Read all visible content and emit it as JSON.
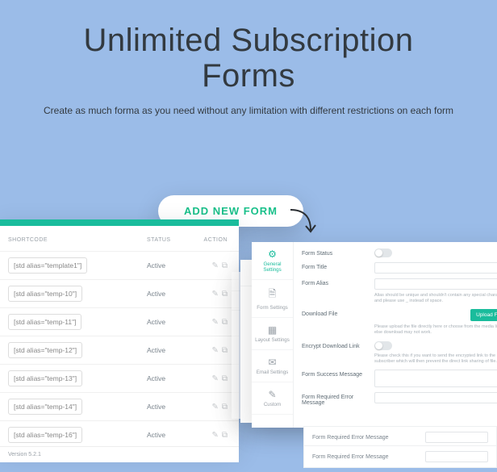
{
  "hero": {
    "title_line1": "Unlimited Subscription",
    "title_line2": "Forms",
    "subtitle": "Create as much forma as you need without any limitation with different restrictions on each form"
  },
  "add_button": "ADD NEW FORM",
  "table": {
    "head_shortcode": "SHORTCODE",
    "head_status": "STATUS",
    "head_action": "ACTION",
    "rows": [
      {
        "code": "[std alias=\"template1\"]",
        "status": "Active"
      },
      {
        "code": "[std alias=\"temp-10\"]",
        "status": "Active"
      },
      {
        "code": "[std alias=\"temp-11\"]",
        "status": "Active"
      },
      {
        "code": "[std alias=\"temp-12\"]",
        "status": "Active"
      },
      {
        "code": "[std alias=\"temp-13\"]",
        "status": "Active"
      },
      {
        "code": "[std alias=\"temp-14\"]",
        "status": "Active"
      },
      {
        "code": "[std alias=\"temp-16\"]",
        "status": "Active"
      }
    ],
    "version": "Version 5.2.1"
  },
  "tabs": {
    "general": "General Settings",
    "form": "Form Settings",
    "layout": "Layout Settings",
    "email": "Email Settings",
    "custom": "Custom"
  },
  "icons": {
    "gear": "⚙",
    "doc": "🗎",
    "layout": "▦",
    "mail": "✉",
    "pencil": "✎",
    "copy": "⧉",
    "edit": "✎"
  },
  "fields": {
    "form_status": "Form Status",
    "form_title": "Form Title",
    "form_alias": "Form Alias",
    "alias_hint": "Alias should be unique and shouldn't contain any special characters and please use _ instead of space.",
    "download_file": "Download File",
    "download_hint": "Please upload the file directly here or choose from the media library else download may not work.",
    "upload_btn": "Upload File",
    "encrypt": "Encrypt Download Link",
    "encrypt_hint": "Please check this if you want to send the encrypted link to the subscriber which will then prevent the direct link sharing of file.",
    "success_msg": "Form Success Message",
    "required_err": "Form Required Error Message"
  }
}
